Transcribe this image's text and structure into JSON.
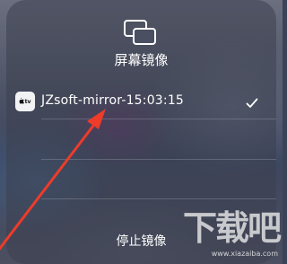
{
  "screen_mirroring": {
    "title": "屏幕镜像",
    "header_icon": "screen-mirroring-icon",
    "devices": [
      {
        "name": "JZsoft-mirror-15:03:15",
        "icon": "apple-tv-icon",
        "icon_text": "tv",
        "selected": true,
        "check_icon": "checkmark-icon"
      }
    ],
    "stop_label": "停止镜像"
  },
  "annotation": {
    "arrow_color": "#ee3b2a"
  },
  "watermark": {
    "main": "下载吧",
    "sub": "www.xiazaiba.com"
  }
}
